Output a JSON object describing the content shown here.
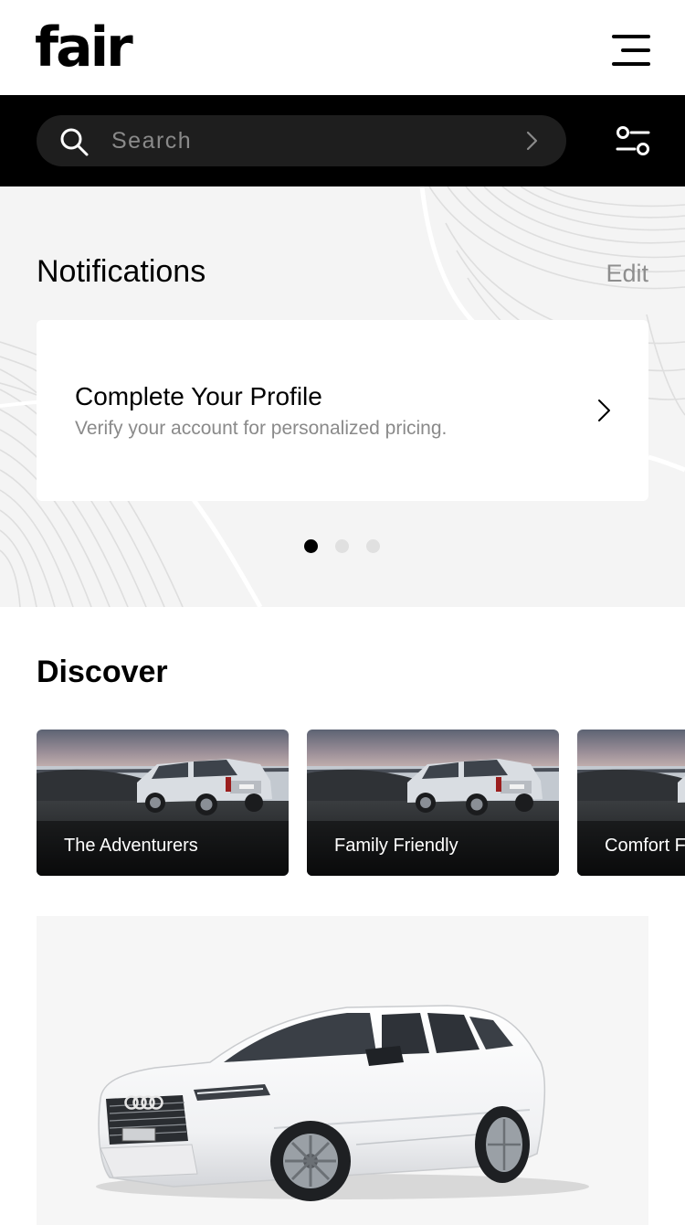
{
  "header": {
    "logo_text": "fair",
    "menu_icon": "hamburger-menu-icon"
  },
  "search": {
    "placeholder": "Search",
    "search_icon": "search-icon",
    "go_icon": "chevron-right-icon",
    "filter_icon": "filter-sliders-icon"
  },
  "notifications": {
    "title": "Notifications",
    "edit_label": "Edit",
    "card": {
      "title": "Complete Your Profile",
      "subtitle": "Verify your account for personalized pricing."
    },
    "pagination": {
      "total": 3,
      "active_index": 0
    }
  },
  "discover": {
    "title": "Discover",
    "cards": [
      {
        "label": "The Adventurers"
      },
      {
        "label": "Family Friendly"
      },
      {
        "label": "Comfort F"
      }
    ]
  },
  "colors": {
    "brand_black": "#000000",
    "search_field": "#1e1e1e",
    "section_bg": "#f4f4f4",
    "muted_text": "#8a8a8a"
  }
}
